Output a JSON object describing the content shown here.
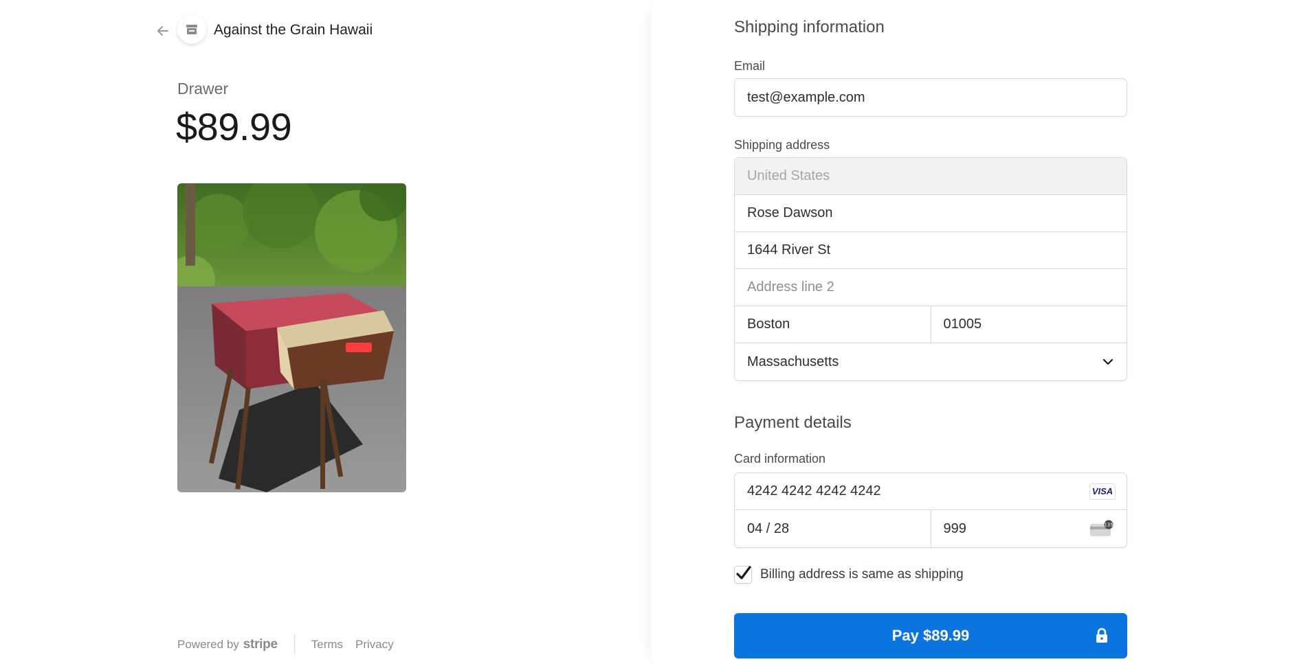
{
  "merchant": {
    "name": "Against the Grain Hawaii",
    "back_icon": "arrow-left-icon",
    "store_icon": "store-icon"
  },
  "product": {
    "name": "Drawer",
    "price": "$89.99",
    "image_alt": "Wooden side table with red top and open drawer"
  },
  "footer": {
    "powered_by": "Powered by",
    "stripe": "stripe",
    "terms": "Terms",
    "privacy": "Privacy"
  },
  "shipping": {
    "title": "Shipping information",
    "email_label": "Email",
    "email_value": "test@example.com",
    "address_label": "Shipping address",
    "country": "United States",
    "name": "Rose Dawson",
    "line1": "1644 River St",
    "line2_placeholder": "Address line 2",
    "city": "Boston",
    "zip": "01005",
    "state": "Massachusetts"
  },
  "payment": {
    "title": "Payment details",
    "card_label": "Card information",
    "card_number": "4242 4242 4242 4242",
    "card_brand": "VISA",
    "expiry": "04 / 28",
    "cvc": "999",
    "cvc_badge": "135",
    "billing_same": "Billing address is same as shipping",
    "billing_checked": true,
    "pay_label": "Pay $89.99"
  },
  "colors": {
    "pay_button": "#0b74de",
    "text_muted": "#6b6b6b"
  }
}
